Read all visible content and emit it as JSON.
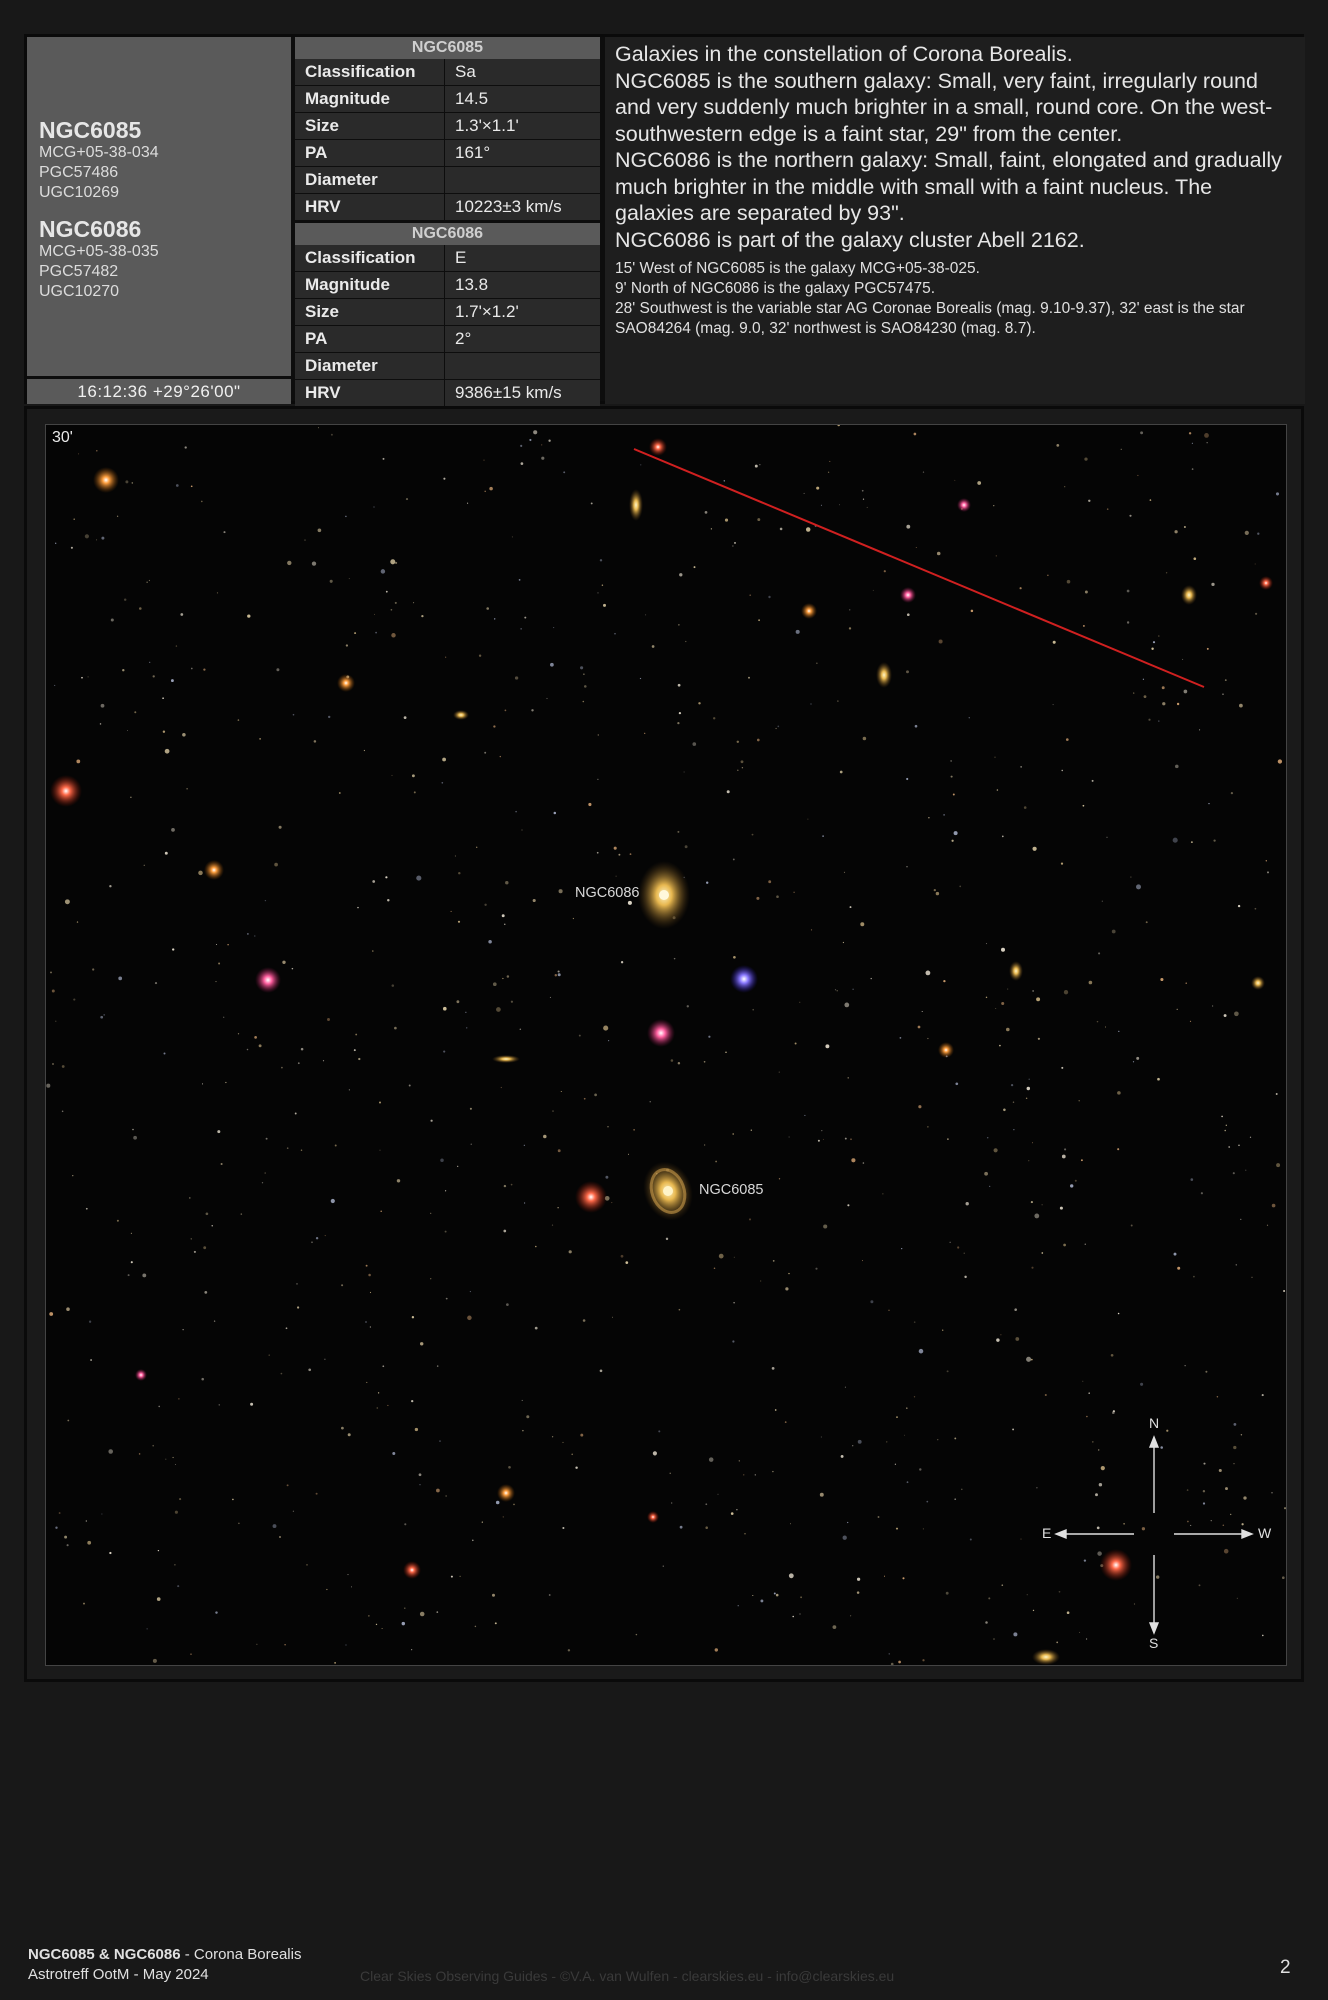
{
  "objects": [
    {
      "name": "NGC6085",
      "aliases": [
        "MCG+05-38-034",
        "PGC57486",
        "UGC10269"
      ]
    },
    {
      "name": "NGC6086",
      "aliases": [
        "MCG+05-38-035",
        "PGC57482",
        "UGC10270"
      ]
    }
  ],
  "coordinates": "16:12:36 +29°26'00\"",
  "tables": [
    {
      "header": "NGC6085",
      "rows": [
        {
          "key": "Classification",
          "value": "Sa"
        },
        {
          "key": "Magnitude",
          "value": "14.5"
        },
        {
          "key": "Size",
          "value": "1.3'×1.1'"
        },
        {
          "key": "PA",
          "value": "161°"
        },
        {
          "key": "Diameter",
          "value": ""
        },
        {
          "key": "HRV",
          "value": "10223±3 km/s"
        }
      ]
    },
    {
      "header": "NGC6086",
      "rows": [
        {
          "key": "Classification",
          "value": "E"
        },
        {
          "key": "Magnitude",
          "value": "13.8"
        },
        {
          "key": "Size",
          "value": "1.7'×1.2'"
        },
        {
          "key": "PA",
          "value": "2°"
        },
        {
          "key": "Diameter",
          "value": ""
        },
        {
          "key": "HRV",
          "value": "9386±15 km/s"
        }
      ]
    }
  ],
  "description": {
    "main": [
      "Galaxies in the constellation of Corona Borealis.",
      "NGC6085 is the southern galaxy: Small, very faint, irregularly round and very suddenly much brighter in a small, round core. On the west-southwestern edge is a faint star, 29\" from the center.",
      "NGC6086 is the northern galaxy: Small, faint, elongated and gradually much brighter in the middle with small with a faint nucleus. The galaxies are separated by 93\".",
      "NGC6086 is part of the galaxy cluster Abell 2162."
    ],
    "notes": [
      "15' West of NGC6085 is the galaxy MCG+05-38-025.",
      "9' North of NGC6086 is the galaxy PGC57475.",
      "28' Southwest is the variable star AG Coronae Borealis (mag. 9.10-9.37), 32' east is the star SAO84264 (mag. 9.0, 32' northwest is SAO84230 (mag. 8.7)."
    ]
  },
  "image": {
    "scale": "30'",
    "labels": {
      "ngc6086": "NGC6086",
      "ngc6085": "NGC6085"
    },
    "compass": {
      "n": "N",
      "s": "S",
      "e": "E",
      "w": "W"
    }
  },
  "footer": {
    "title_bold": "NGC6085 & NGC6086",
    "title_rest": " - Corona Borealis",
    "subtitle": "Astrotreff OotM - May 2024",
    "credit": "Clear Skies Observing Guides - ©V.A. van Wulfen - clearskies.eu - info@clearskies.eu",
    "page": "2"
  }
}
